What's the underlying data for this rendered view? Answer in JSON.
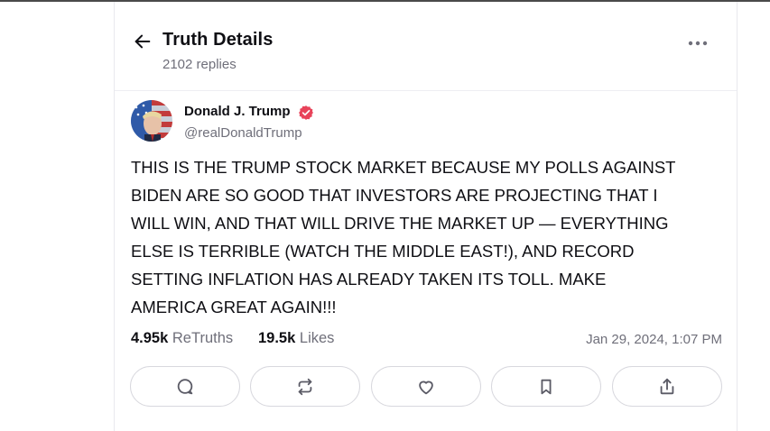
{
  "header": {
    "title": "Truth Details",
    "replies": "2102 replies"
  },
  "post": {
    "author_name": "Donald J. Trump",
    "handle": "@realDonaldTrump",
    "verified": true,
    "body": "THIS IS THE TRUMP STOCK MARKET BECAUSE MY POLLS AGAINST\nBIDEN ARE SO GOOD THAT INVESTORS ARE PROJECTING THAT I\nWILL WIN, AND THAT WILL DRIVE THE MARKET UP — EVERYTHING\nELSE IS TERRIBLE (WATCH THE MIDDLE EAST!), AND RECORD\nSETTING INFLATION HAS ALREADY TAKEN ITS TOLL. MAKE\nAMERICA GREAT AGAIN!!!",
    "retruths_count": "4.95k",
    "retruths_label": "ReTruths",
    "likes_count": "19.5k",
    "likes_label": "Likes",
    "timestamp": "Jan 29, 2024, 1:07 PM"
  },
  "icons": {
    "back": "arrow-left-icon",
    "more": "more-horizontal-icon",
    "verified": "verified-badge-icon",
    "reply": "reply-bubble-icon",
    "retruth": "repost-icon",
    "like": "heart-icon",
    "bookmark": "bookmark-icon",
    "share": "share-icon"
  },
  "colors": {
    "text": "#0f0f14",
    "muted": "#6f6f7a",
    "verified": "#e8435a",
    "border": "#d8d8de"
  }
}
